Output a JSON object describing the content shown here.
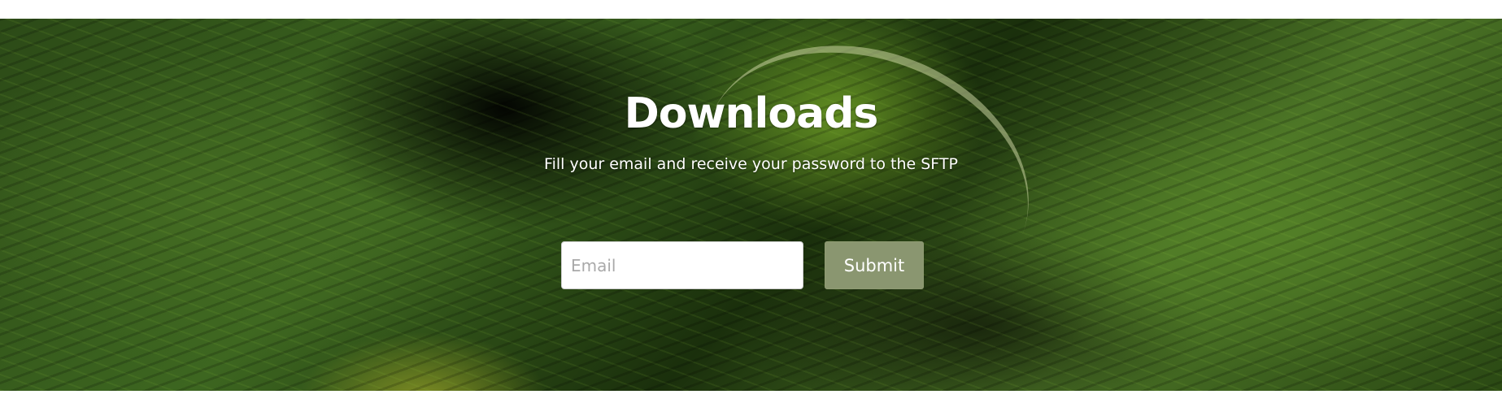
{
  "hero": {
    "title": "Downloads",
    "subtitle": "Fill your email and receive your password to the SFTP",
    "email_placeholder": "Email",
    "email_value": "",
    "submit_label": "Submit"
  },
  "colors": {
    "button_background": "#8a9670",
    "text": "#ffffff",
    "input_background": "#ffffff"
  }
}
